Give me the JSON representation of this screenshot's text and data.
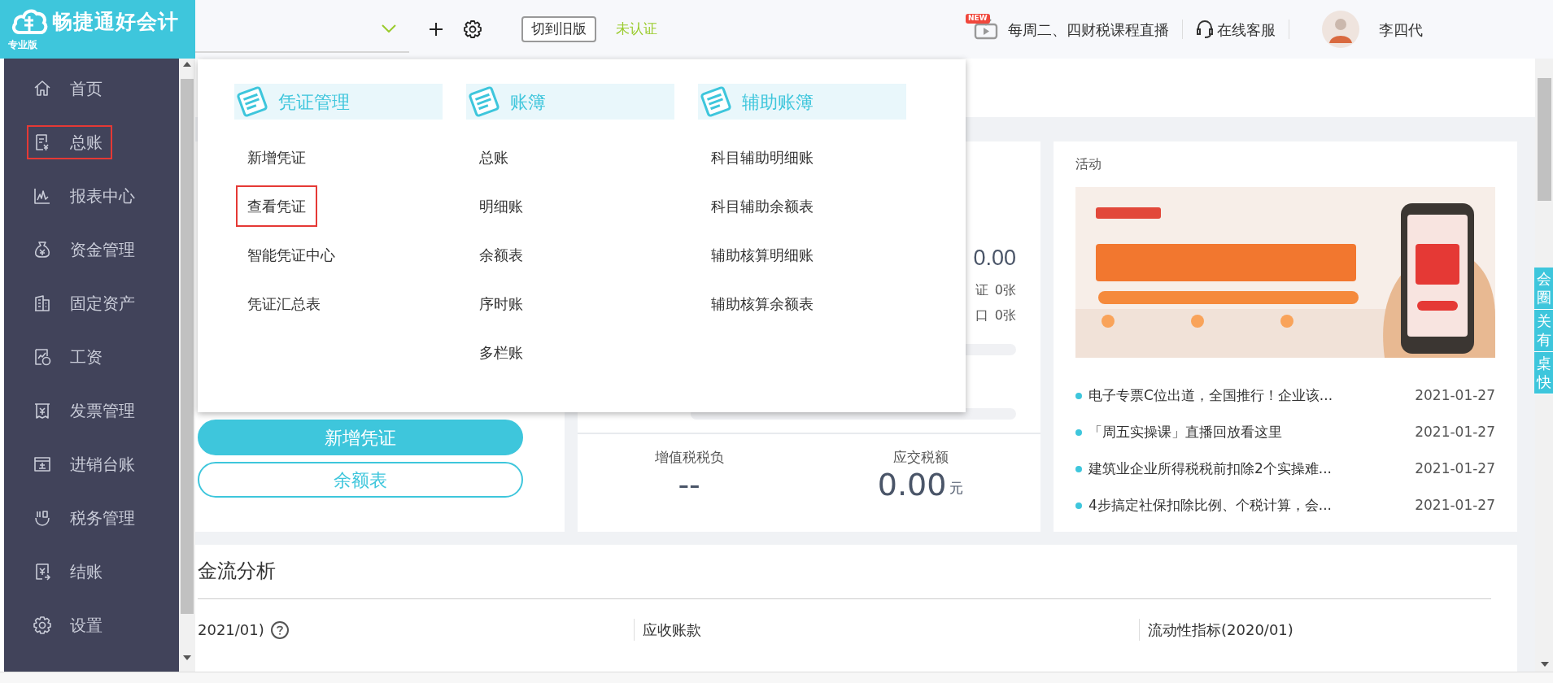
{
  "app": {
    "logo": "畅捷通好会计",
    "edition": "专业版"
  },
  "topbar": {
    "switch_button": "切到旧版",
    "cert_status": "未认证",
    "live_badge": "NEW",
    "live_text": "每周二、四财税课程直播",
    "service": "在线客服",
    "user": "李四代"
  },
  "sidebar": {
    "items": [
      {
        "label": "首页",
        "kind": "home",
        "highlighted": false
      },
      {
        "label": "总账",
        "kind": "ledger",
        "highlighted": true
      },
      {
        "label": "报表中心",
        "kind": "chart",
        "highlighted": false
      },
      {
        "label": "资金管理",
        "kind": "moneybag",
        "highlighted": false
      },
      {
        "label": "固定资产",
        "kind": "building",
        "highlighted": false
      },
      {
        "label": "工资",
        "kind": "salary",
        "highlighted": false
      },
      {
        "label": "发票管理",
        "kind": "invoice",
        "highlighted": false
      },
      {
        "label": "进销台账",
        "kind": "stock",
        "highlighted": false
      },
      {
        "label": "税务管理",
        "kind": "tax",
        "highlighted": false
      },
      {
        "label": "结账",
        "kind": "close",
        "highlighted": false
      },
      {
        "label": "设置",
        "kind": "settings",
        "highlighted": false
      }
    ]
  },
  "menu": {
    "groups": [
      {
        "title": "凭证管理",
        "items": [
          {
            "label": "新增凭证",
            "highlighted": false
          },
          {
            "label": "查看凭证",
            "highlighted": true
          },
          {
            "label": "智能凭证中心",
            "highlighted": false
          },
          {
            "label": "凭证汇总表",
            "highlighted": false
          }
        ]
      },
      {
        "title": "账簿",
        "items": [
          {
            "label": "总账",
            "highlighted": false
          },
          {
            "label": "明细账",
            "highlighted": false
          },
          {
            "label": "余额表",
            "highlighted": false
          },
          {
            "label": "序时账",
            "highlighted": false
          },
          {
            "label": "多栏账",
            "highlighted": false
          }
        ]
      },
      {
        "title": "辅助账簿",
        "items": [
          {
            "label": "科目辅助明细账",
            "highlighted": false
          },
          {
            "label": "科目辅助余额表",
            "highlighted": false
          },
          {
            "label": "辅助核算明细账",
            "highlighted": false
          },
          {
            "label": "辅助核算余额表",
            "highlighted": false
          }
        ]
      }
    ]
  },
  "quick_actions": [
    {
      "label": "新增凭证",
      "kind": "filled"
    },
    {
      "label": "余额表",
      "kind": "outline"
    }
  ],
  "summary": {
    "amount": "0.00",
    "rows": [
      {
        "label": "证",
        "value": "0张"
      },
      {
        "label": "口",
        "value": "0张"
      }
    ],
    "tax": [
      {
        "label": "增值税税负",
        "value": "--"
      },
      {
        "label": "应交税额",
        "value": "0.00",
        "unit": "元"
      }
    ]
  },
  "activity": {
    "title": "活动",
    "news": [
      {
        "title": "电子专票C位出道，全国推行！企业该...",
        "date": "2021-01-27"
      },
      {
        "title": "「周五实操课」直播回放看这里",
        "date": "2021-01-27"
      },
      {
        "title": "建筑业企业所得税税前扣除2个实操难...",
        "date": "2021-01-27"
      },
      {
        "title": "4步搞定社保扣除比例、个税计算，会...",
        "date": "2021-01-27"
      }
    ]
  },
  "analysis": {
    "title": "金流分析",
    "columns": [
      {
        "label": "2021/01)",
        "help": true
      },
      {
        "label": "应收账款",
        "help": false
      },
      {
        "label": "流动性指标(2020/01)",
        "help": false
      }
    ]
  },
  "side_tabs": [
    "会圈",
    "关有",
    "桌快"
  ]
}
